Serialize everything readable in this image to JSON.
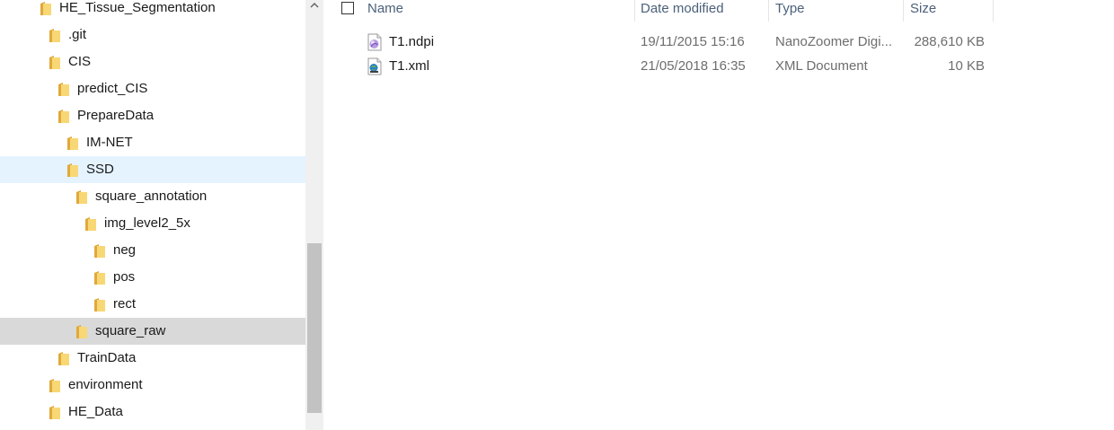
{
  "navigation": {
    "items": [
      {
        "label": "HE_Tissue_Segmentation",
        "level": 0,
        "state": "normal"
      },
      {
        "label": ".git",
        "level": 1,
        "state": "normal"
      },
      {
        "label": "CIS",
        "level": 1,
        "state": "normal"
      },
      {
        "label": "predict_CIS",
        "level": 2,
        "state": "normal"
      },
      {
        "label": "PrepareData",
        "level": 2,
        "state": "normal"
      },
      {
        "label": "IM-NET",
        "level": 3,
        "state": "normal"
      },
      {
        "label": "SSD",
        "level": 3,
        "state": "selected"
      },
      {
        "label": "square_annotation",
        "level": 4,
        "state": "normal"
      },
      {
        "label": "img_level2_5x",
        "level": 5,
        "state": "normal"
      },
      {
        "label": "neg",
        "level": 6,
        "state": "normal"
      },
      {
        "label": "pos",
        "level": 6,
        "state": "normal"
      },
      {
        "label": "rect",
        "level": 6,
        "state": "normal"
      },
      {
        "label": "square_raw",
        "level": 4,
        "state": "hovered"
      },
      {
        "label": "TrainData",
        "level": 2,
        "state": "normal"
      },
      {
        "label": "environment",
        "level": 1,
        "state": "normal"
      },
      {
        "label": "HE_Data",
        "level": 1,
        "state": "normal"
      }
    ]
  },
  "columns": {
    "name": "Name",
    "date_modified": "Date modified",
    "type": "Type",
    "size": "Size"
  },
  "files": [
    {
      "name": "T1.ndpi",
      "date_modified": "19/11/2015 15:16",
      "type": "NanoZoomer Digi...",
      "size": "288,610 KB",
      "icon": "ndpi-file-icon"
    },
    {
      "name": "T1.xml",
      "date_modified": "21/05/2018 16:35",
      "type": "XML Document",
      "size": "10 KB",
      "icon": "xml-file-icon"
    }
  ],
  "colors": {
    "selected_bg": "#e5f3ff",
    "hover_bg": "#d9d9d9",
    "folder_yellow": "#f8d775",
    "header_text": "#4c607a"
  }
}
